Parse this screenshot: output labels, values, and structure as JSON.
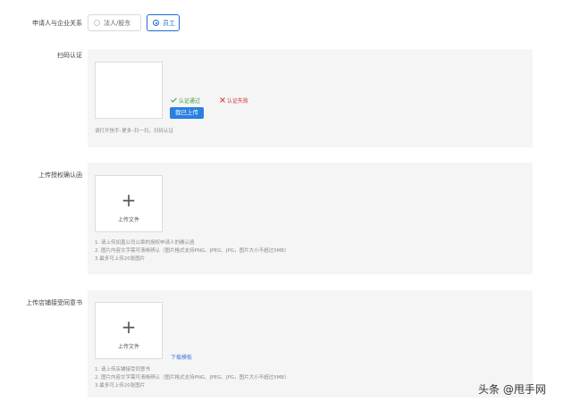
{
  "relation": {
    "label": "申请人与企业关系",
    "options": [
      {
        "label": "法人/股东",
        "selected": false
      },
      {
        "label": "员工",
        "selected": true
      }
    ]
  },
  "scan": {
    "label": "扫码认证",
    "status_pass": "认证通过",
    "status_fail": "认证失败",
    "uploaded_button": "我已上传",
    "hint": "请打开快手–更多–扫一扫，扫码认证"
  },
  "auth_letter": {
    "label": "上传授权确认函",
    "upload_text": "上传文件",
    "hints": [
      "1. 请上传加盖公司公章的授权申请人的确认函",
      "2. 图片内容文字需可清晰辨认（图片格式支持PNG、JPEG、JPG，图片大小不超过5MB）",
      "3.最多可上传20张图片"
    ]
  },
  "consent_letter": {
    "label": "上传店铺接受同意书",
    "upload_text": "上传文件",
    "download_link": "下载模板",
    "hints": [
      "1. 请上传店铺接受同意书",
      "2. 图片内容文字需可清晰辨认（图片格式支持PNG、JPEG、JPG，图片大小不超过5MB）",
      "3.最多可上传20张图片"
    ]
  },
  "watermark": "头条 @甩手网",
  "colors": {
    "primary": "#2b7fe0",
    "success": "#3a9c3a",
    "error": "#d9363e",
    "panel_bg": "#f5f5f6"
  }
}
